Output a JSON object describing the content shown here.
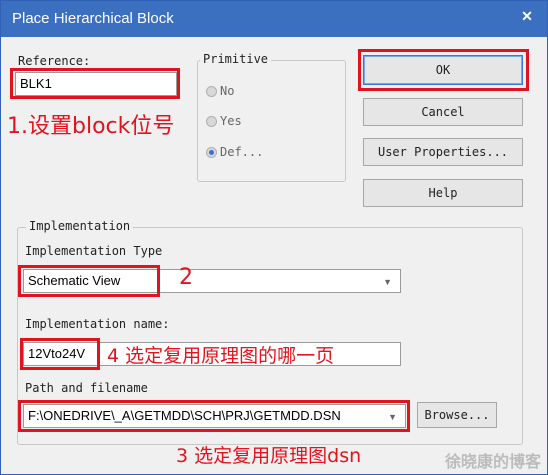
{
  "window": {
    "title": "Place Hierarchical Block",
    "close_glyph": "✕"
  },
  "reference": {
    "label": "Reference:",
    "value": "BLK1"
  },
  "primitive": {
    "title": "Primitive",
    "options": [
      {
        "label": "No",
        "selected": false
      },
      {
        "label": "Yes",
        "selected": false
      },
      {
        "label": "Def...",
        "selected": true
      }
    ]
  },
  "buttons": {
    "ok": "OK",
    "cancel": "Cancel",
    "user_properties": "User Properties...",
    "help": "Help",
    "browse": "Browse..."
  },
  "implementation": {
    "title": "Implementation",
    "type_label": "Implementation Type",
    "type_value": "Schematic View",
    "name_label": "Implementation name:",
    "name_value": "12Vto24V",
    "path_label": "Path and filename",
    "path_value": "F:\\ONEDRIVE\\_A\\GETMDD\\SCH\\PRJ\\GETMDD.DSN"
  },
  "annotations": {
    "step1": "1.设置block位号",
    "step2": "2",
    "step4": "4 选定复用原理图的哪一页",
    "step3": "3 选定复用原理图dsn"
  },
  "watermark": "徐晓康的博客",
  "colors": {
    "title_bar": "#3b6fbf",
    "annotation_red": "#e0141e",
    "dialog_bg": "#f0f0f0"
  }
}
